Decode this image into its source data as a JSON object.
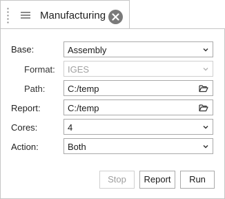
{
  "tab": {
    "title": "Manufacturing"
  },
  "form": {
    "base": {
      "label": "Base:",
      "value": "Assembly"
    },
    "format": {
      "label": "Format:",
      "value": "IGES"
    },
    "path": {
      "label": "Path:",
      "value": "C:/temp"
    },
    "report": {
      "label": "Report:",
      "value": "C:/temp"
    },
    "cores": {
      "label": "Cores:",
      "value": "4"
    },
    "action": {
      "label": "Action:",
      "value": "Both"
    }
  },
  "buttons": {
    "stop": "Stop",
    "report": "Report",
    "run": "Run"
  },
  "icons": {
    "grip": "drag-grip-icon",
    "menu": "hamburger-menu-icon",
    "close": "close-circle-icon",
    "dropdown": "chevron-down-icon",
    "folder": "folder-open-icon"
  },
  "colors": {
    "border": "#a9a9a9",
    "disabled_text": "#a0a0a0",
    "close_bg": "#7a7a7a"
  }
}
